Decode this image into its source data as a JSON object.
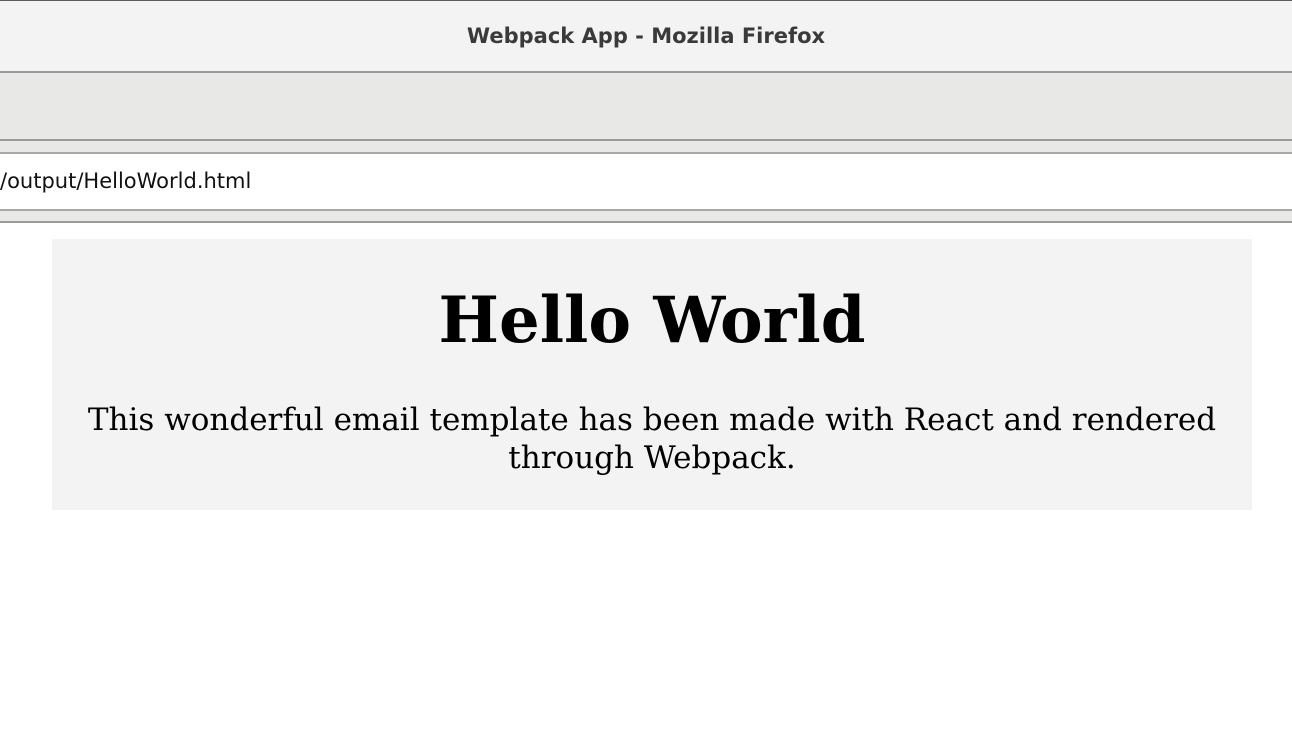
{
  "window": {
    "title": "Webpack App - Mozilla Firefox"
  },
  "navbar": {
    "url": "/output/HelloWorld.html"
  },
  "page": {
    "heading": "Hello World",
    "body": "This wonderful email template has been made with React and rendered through Webpack."
  },
  "colors": {
    "titlebar_bg": "#f3f3f3",
    "toolbar_bg": "#e8e8e7",
    "email_box_bg": "#f3f3f3",
    "text": "#000000"
  }
}
